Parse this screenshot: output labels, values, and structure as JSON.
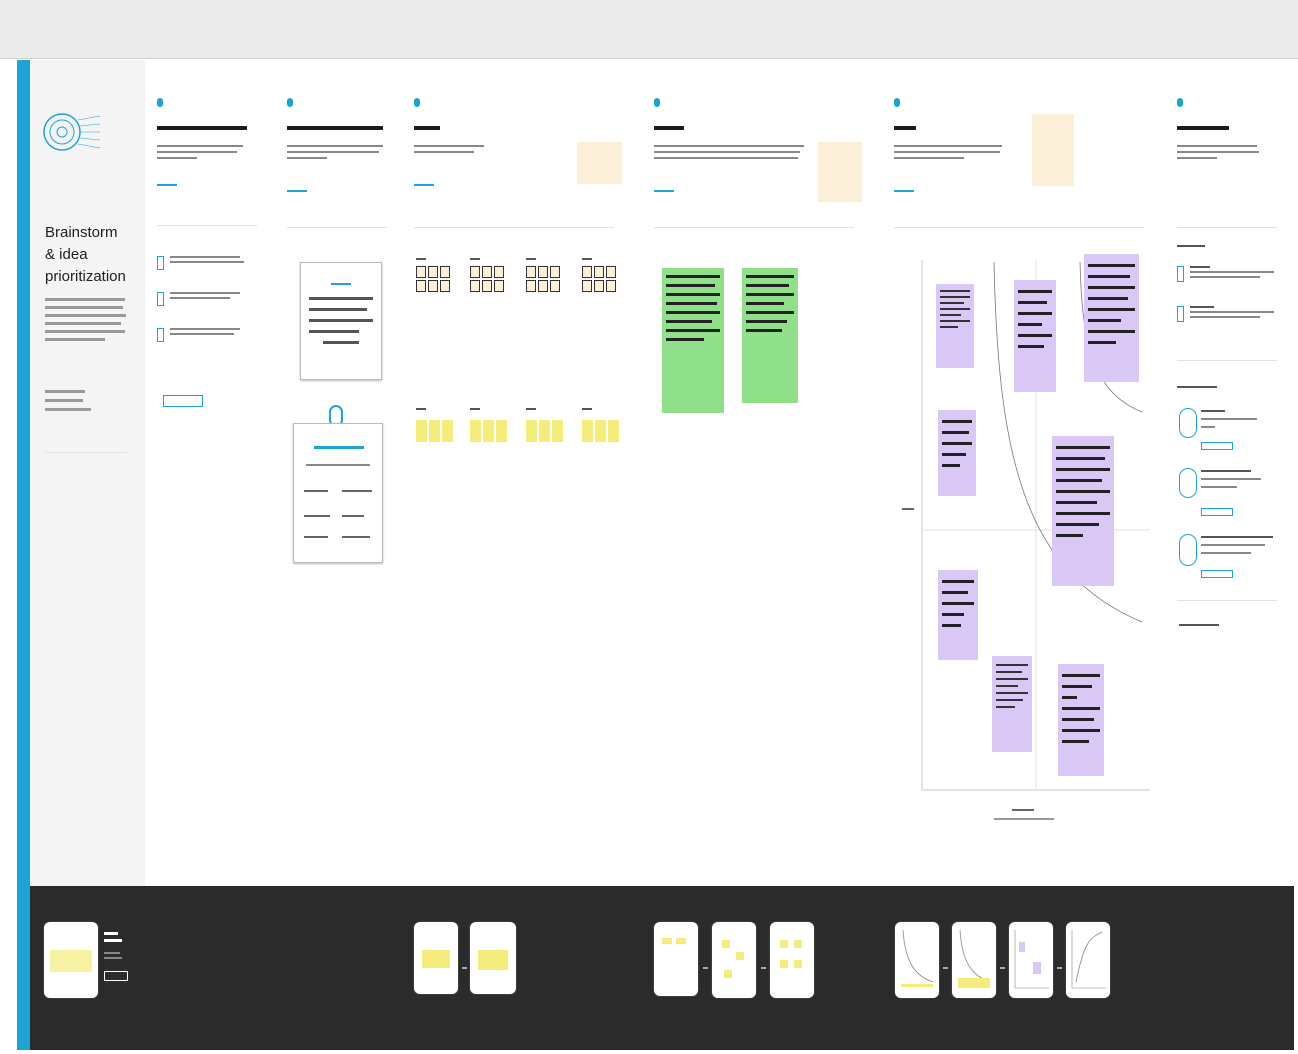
{
  "intro": {
    "title_line1": "Brainstorm",
    "title_line2": "& idea prioritization"
  },
  "colors": {
    "accent": "#1ea4d4",
    "sticky_purple": "#d9c8f5",
    "sticky_green": "#90e08a",
    "sticky_yellow": "#f4ec7a",
    "note_tan": "#fbefd7",
    "bottom_bar": "#2b2b2b"
  },
  "icons": {
    "template_hero": "target-icon"
  }
}
